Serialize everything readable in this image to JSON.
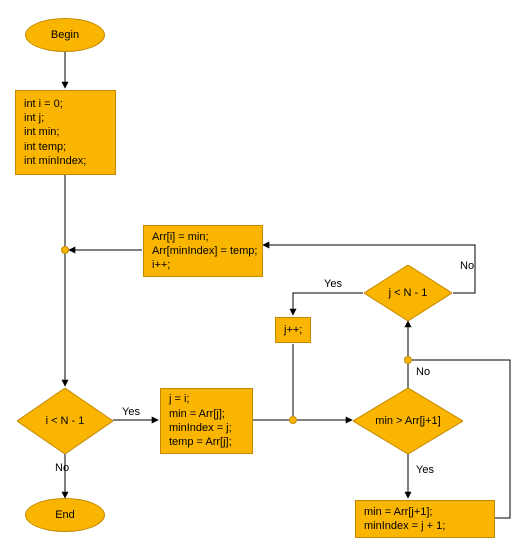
{
  "chart_data": {
    "type": "flowchart",
    "nodes": [
      {
        "id": "begin",
        "kind": "terminator",
        "label": "Begin"
      },
      {
        "id": "init",
        "kind": "process",
        "lines": [
          "int i = 0;",
          "int j;",
          "int min;",
          "int temp;",
          "int minIndex;"
        ]
      },
      {
        "id": "d_i",
        "kind": "decision",
        "label": "i < N - 1"
      },
      {
        "id": "setj",
        "kind": "process",
        "lines": [
          "j = i;",
          "min = Arr[j];",
          "minIndex = j;",
          "temp = Arr[j];"
        ]
      },
      {
        "id": "d_min",
        "kind": "decision",
        "label": "min > Arr[j+1]"
      },
      {
        "id": "upd_min",
        "kind": "process",
        "lines": [
          "min = Arr[j+1];",
          "minIndex = j + 1;"
        ]
      },
      {
        "id": "d_j",
        "kind": "decision",
        "label": "j < N - 1"
      },
      {
        "id": "jpp",
        "kind": "process",
        "lines": [
          "j++;"
        ]
      },
      {
        "id": "swap",
        "kind": "process",
        "lines": [
          "Arr[i] = min;",
          "Arr[minIndex] = temp;",
          "i++;"
        ]
      },
      {
        "id": "end",
        "kind": "terminator",
        "label": "End"
      }
    ],
    "edges": [
      {
        "from": "begin",
        "to": "init"
      },
      {
        "from": "init",
        "to": "d_i"
      },
      {
        "from": "d_i",
        "to": "setj",
        "label": "Yes"
      },
      {
        "from": "d_i",
        "to": "end",
        "label": "No"
      },
      {
        "from": "setj",
        "to": "d_min"
      },
      {
        "from": "d_min",
        "to": "upd_min",
        "label": "Yes"
      },
      {
        "from": "d_min",
        "to": "d_j",
        "label": "No"
      },
      {
        "from": "upd_min",
        "to": "d_j"
      },
      {
        "from": "d_j",
        "to": "jpp",
        "label": "Yes"
      },
      {
        "from": "jpp",
        "to": "d_min"
      },
      {
        "from": "d_j",
        "to": "swap",
        "label": "No"
      },
      {
        "from": "swap",
        "to": "d_i"
      }
    ]
  },
  "labels": {
    "begin": "Begin",
    "end": "End",
    "init": "int i = 0;\nint j;\nint min;\nint temp;\nint minIndex;",
    "d_i": "i < N - 1",
    "setj": "j = i;\nmin = Arr[j];\nminIndex = j;\ntemp = Arr[j];",
    "d_min": "min > Arr[j+1]",
    "upd_min": "min = Arr[j+1];\nminIndex = j + 1;",
    "d_j": "j < N - 1",
    "jpp": "j++;",
    "swap": "Arr[i] = min;\nArr[minIndex] = temp;\ni++;",
    "yes": "Yes",
    "no": "No"
  }
}
